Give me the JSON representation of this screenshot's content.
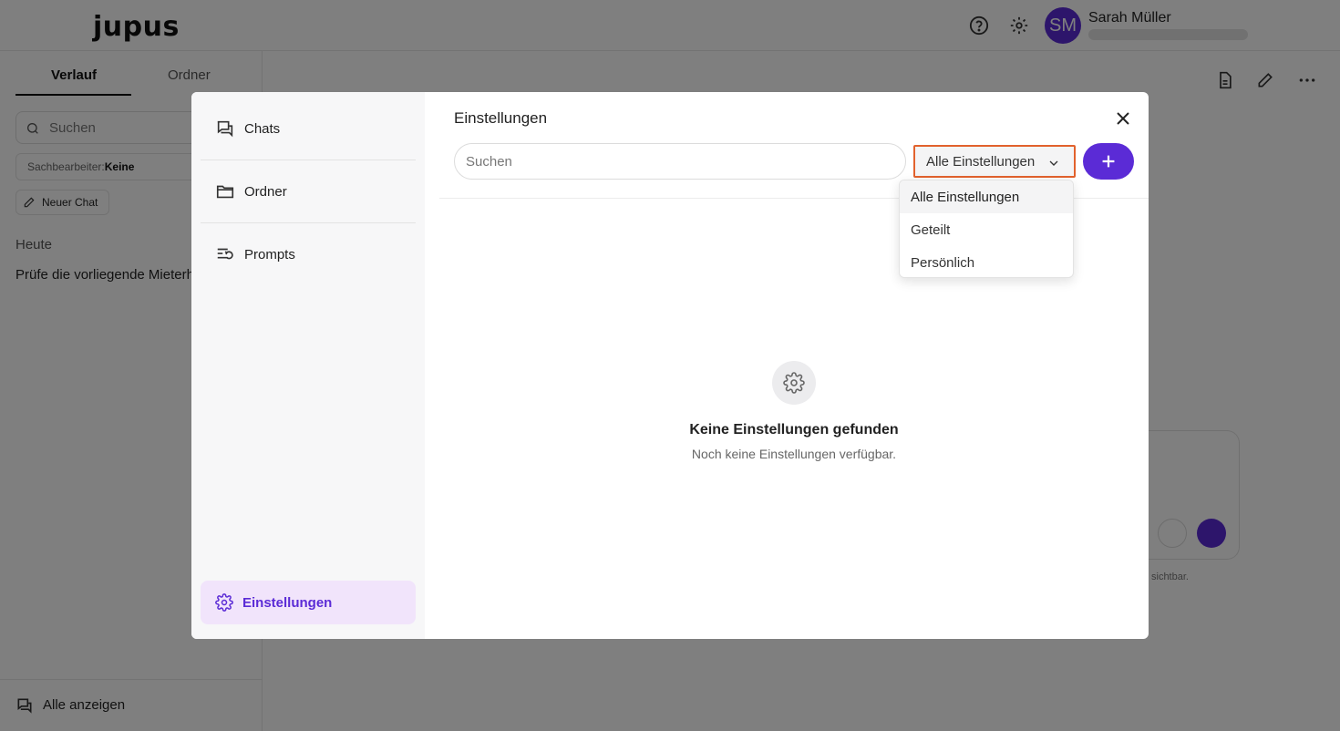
{
  "app": {
    "logo": "jupus",
    "user": {
      "initials": "SM",
      "name": "Sarah Müller"
    },
    "brand_color": "#5b2bd6"
  },
  "sidebar": {
    "tabs": [
      "Verlauf",
      "Ordner"
    ],
    "search_placeholder": "Suchen",
    "filter_label": "Sachbearbeiter:",
    "filter_value": "Keine",
    "new_chat": "Neuer Chat",
    "section_today": "Heute",
    "chat_item": "Prüfe die vorliegende Mieterh",
    "show_all": "Alle anzeigen"
  },
  "main": {
    "note": "sichtbar."
  },
  "modal": {
    "title": "Einstellungen",
    "nav": [
      {
        "label": "Chats",
        "icon": "chats-icon"
      },
      {
        "label": "Ordner",
        "icon": "folder-icon"
      },
      {
        "label": "Prompts",
        "icon": "prompts-icon"
      },
      {
        "label": "Einstellungen",
        "icon": "gear-icon"
      }
    ],
    "search_placeholder": "Suchen",
    "filter": {
      "selected": "Alle Einstellungen",
      "options": [
        "Alle Einstellungen",
        "Geteilt",
        "Persönlich"
      ]
    },
    "empty": {
      "title": "Keine Einstellungen gefunden",
      "subtitle": "Noch keine Einstellungen verfügbar."
    }
  }
}
